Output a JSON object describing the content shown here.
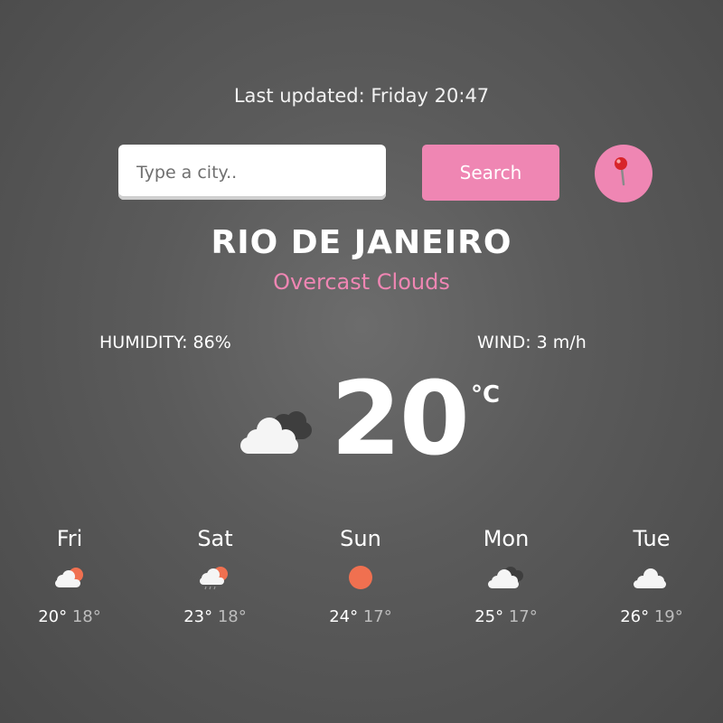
{
  "last_updated": "Last updated: Friday 20:47",
  "search": {
    "placeholder": "Type a city..",
    "value": "",
    "button_label": "Search"
  },
  "location_button_icon": "map-pin-icon",
  "city": "RIO DE JANEIRO",
  "description": "Overcast Clouds",
  "humidity": "HUMIDITY: 86%",
  "wind": "WIND: 3 m/h",
  "temperature": "20",
  "unit": "°C",
  "current_icon": "overcast-clouds-icon",
  "colors": {
    "accent": "#ef86b3",
    "sun": "#f07050",
    "cloud": "#f5f5f5",
    "dark_cloud": "#3e3e3e"
  },
  "forecast": [
    {
      "day": "Fri",
      "max": "20°",
      "min": "18°",
      "icon": "partly-cloudy-icon"
    },
    {
      "day": "Sat",
      "max": "23°",
      "min": "18°",
      "icon": "partly-cloudy-rain-icon"
    },
    {
      "day": "Sun",
      "max": "24°",
      "min": "17°",
      "icon": "sun-icon"
    },
    {
      "day": "Mon",
      "max": "25°",
      "min": "17°",
      "icon": "broken-clouds-icon"
    },
    {
      "day": "Tue",
      "max": "26°",
      "min": "19°",
      "icon": "cloud-icon"
    }
  ]
}
